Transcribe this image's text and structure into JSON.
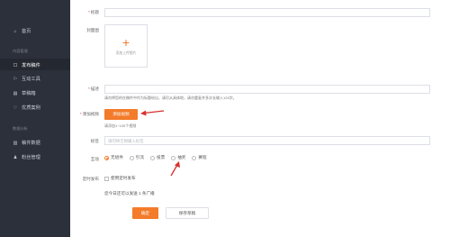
{
  "sidebar": {
    "items": [
      {
        "label": "首页",
        "icon": "home-icon",
        "glyph": "⌂"
      },
      {
        "label": "发布稿件",
        "icon": "publish-icon",
        "glyph": "☐"
      },
      {
        "label": "互动工具",
        "icon": "tool-icon",
        "glyph": "⚐"
      },
      {
        "label": "草稿箱",
        "icon": "draft-icon",
        "glyph": "▤"
      },
      {
        "label": "优质案例",
        "icon": "case-icon",
        "glyph": "♡"
      },
      {
        "label": "稿件数据",
        "icon": "chart-icon",
        "glyph": "▥"
      },
      {
        "label": "粉丝管理",
        "icon": "fans-icon",
        "glyph": "♟"
      }
    ],
    "sections": [
      "内容管理",
      "数据分析"
    ]
  },
  "form": {
    "title_label": "标题",
    "cover_label": "封面图",
    "cover_caption": "添加上传图片",
    "desc_label": "描述",
    "desc_hint": "请勿将您的在稿件中作为标题给出，请尽从具体地，请勿重复并多次长输入125字。",
    "video_label": "添加视频",
    "video_button": "添加视频",
    "video_hint": "请添加1~100个视频",
    "tags_label": "标签",
    "tags_placeholder": "请勿将全网输入标签",
    "interact_label": "互动",
    "interact_options": [
      "无组件",
      "引流",
      "投票",
      "抽奖",
      "赛程"
    ],
    "schedule_label": "定时发布",
    "schedule_check": "使用定时发布",
    "quota_text": "您今日还可以发送 1 条广播",
    "submit_button": "确定",
    "save_button": "保存草稿"
  },
  "colors": {
    "accent": "#f37b2a",
    "sidebar_bg": "#2b303b",
    "arrow": "#d9302c"
  }
}
